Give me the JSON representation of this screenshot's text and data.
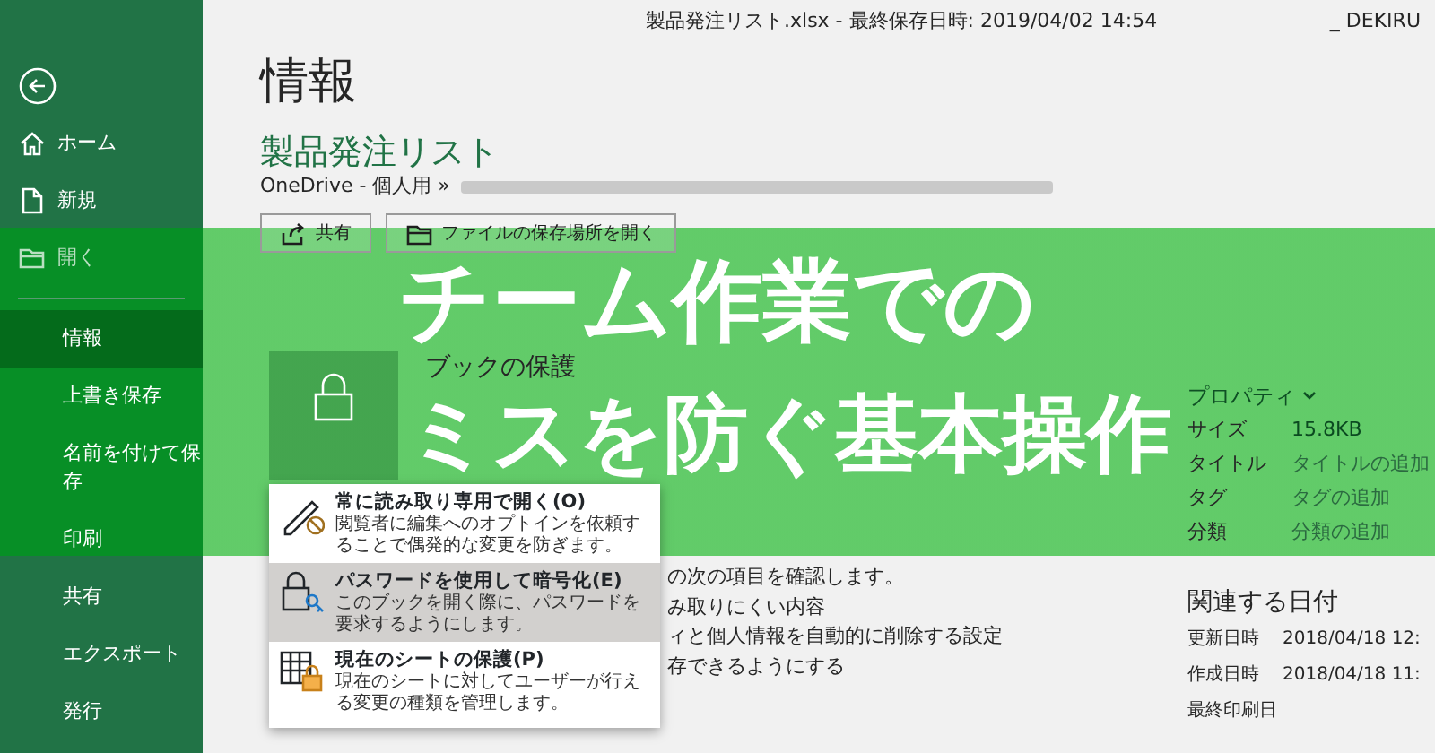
{
  "window": {
    "title": "製品発注リスト.xlsx - 最終保存日時: 2019/04/02 14:54",
    "user": "_ DEKIRU"
  },
  "sidebar": {
    "groups": [
      [
        {
          "label": "ホーム",
          "disabled": false,
          "selected": false
        },
        {
          "label": "新規",
          "disabled": false,
          "selected": false
        },
        {
          "label": "開く",
          "disabled": true,
          "selected": false
        }
      ],
      [
        {
          "label": "情報",
          "disabled": false,
          "selected": true
        },
        {
          "label": "上書き保存",
          "disabled": false,
          "selected": false
        },
        {
          "label": "名前を付けて保存",
          "disabled": false,
          "selected": false
        },
        {
          "label": "印刷",
          "disabled": false,
          "selected": false
        },
        {
          "label": "共有",
          "disabled": false,
          "selected": false
        },
        {
          "label": "エクスポート",
          "disabled": false,
          "selected": false
        },
        {
          "label": "発行",
          "disabled": false,
          "selected": false
        }
      ]
    ]
  },
  "info": {
    "heading": "情報",
    "file_name": "製品発注リスト",
    "path": "OneDrive - 個人用 »",
    "buttons": [
      "共有",
      "ファイルの保存場所を開く"
    ]
  },
  "protect": {
    "heading": "ブックの保護",
    "menu": [
      {
        "title": "常に読み取り専用で開く(O)",
        "description": "閲覧者に編集へのオプトインを依頼することで偶発的な変更を防ぎます。",
        "selected": false
      },
      {
        "title": "パスワードを使用して暗号化(E)",
        "description": "このブックを開く際に、パスワードを要求するようにします。",
        "selected": true
      },
      {
        "title": "現在のシートの保護(P)",
        "description": "現在のシートに対してユーザーが行える変更の種類を管理します。",
        "selected": false
      }
    ]
  },
  "inspect": {
    "lines": [
      "の次の項目を確認します。",
      "み取りにくい内容",
      "ィと個人情報を自動的に削除する設定"
    ],
    "link": "存できるようにする"
  },
  "properties": {
    "heading": "プロパティ",
    "rows": [
      {
        "label": "サイズ",
        "value": "15.8KB",
        "kind": "value"
      },
      {
        "label": "タイトル",
        "value": "タイトルの追加",
        "kind": "add"
      },
      {
        "label": "タグ",
        "value": "タグの追加",
        "kind": "add"
      },
      {
        "label": "分類",
        "value": "分類の追加",
        "kind": "add"
      }
    ]
  },
  "dates": {
    "heading": "関連する日付",
    "rows": [
      {
        "label": "更新日時",
        "value": "2018/04/18 12:"
      },
      {
        "label": "作成日時",
        "value": "2018/04/18 11:"
      },
      {
        "label": "最終印刷日"
      }
    ]
  },
  "banner": {
    "lines": [
      "チーム作業での",
      "ミスを防ぐ基本操作"
    ]
  }
}
